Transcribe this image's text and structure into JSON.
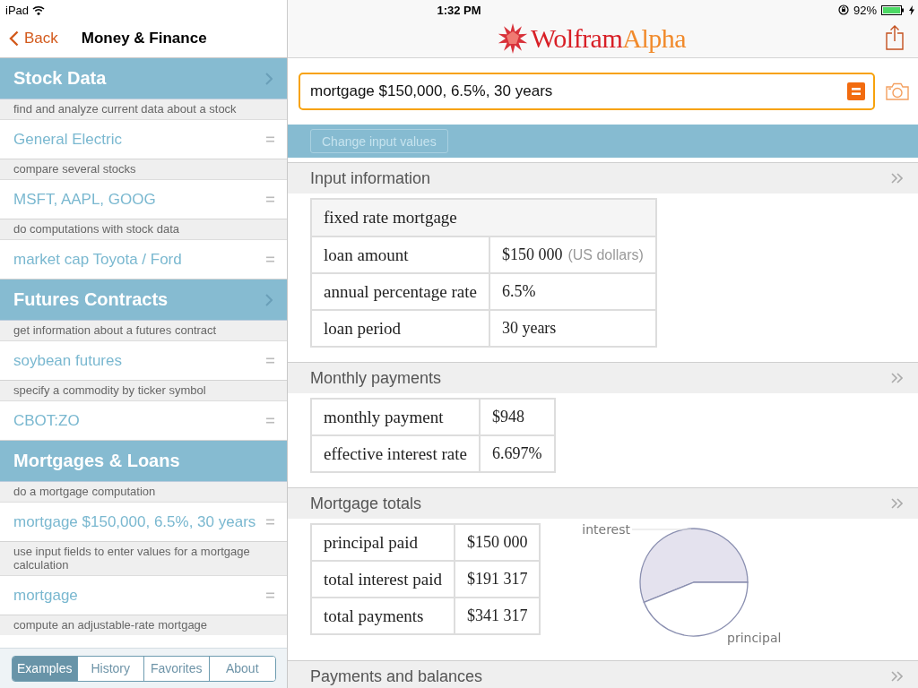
{
  "status_bar": {
    "device": "iPad",
    "time": "1:32 PM",
    "battery": "92%",
    "charging": true
  },
  "sidebar": {
    "back": "Back",
    "title": "Money & Finance",
    "sections": [
      {
        "heading": "Stock Data",
        "expandable": true,
        "examples": [
          {
            "description": "find and analyze current data about a stock",
            "query": "General Electric"
          },
          {
            "description": "compare several stocks",
            "query": "MSFT, AAPL, GOOG"
          },
          {
            "description": "do computations with stock data",
            "query": "market cap Toyota / Ford"
          }
        ]
      },
      {
        "heading": "Futures Contracts",
        "expandable": true,
        "examples": [
          {
            "description": "get information about a futures contract",
            "query": "soybean futures"
          },
          {
            "description": "specify a commodity by ticker symbol",
            "query": "CBOT:ZO"
          }
        ]
      },
      {
        "heading": "Mortgages & Loans",
        "expandable": false,
        "examples": [
          {
            "description": "do a mortgage computation",
            "query": "mortgage $150,000, 6.5%, 30 years"
          },
          {
            "description": "use input fields to enter values for a mortgage calculation",
            "query": "mortgage"
          },
          {
            "description": "compute an adjustable-rate mortgage"
          }
        ]
      }
    ],
    "tabs": [
      {
        "label": "Examples",
        "selected": true
      },
      {
        "label": "History",
        "selected": false
      },
      {
        "label": "Favorites",
        "selected": false
      },
      {
        "label": "About",
        "selected": false
      }
    ]
  },
  "main": {
    "logo": {
      "first": "Wolfram",
      "second": "Alpha"
    },
    "search": {
      "value": "mortgage $150,000, 6.5%, 30 years"
    },
    "change_button": {
      "label": "Change input values",
      "disabled": true
    },
    "pods": [
      {
        "title": "Input information",
        "table": {
          "caption": "fixed rate mortgage",
          "rows": [
            {
              "label": "loan amount",
              "value": "$150 000",
              "unit": "(US dollars)"
            },
            {
              "label": "annual percentage rate",
              "value": "6.5%"
            },
            {
              "label": "loan period",
              "value": "30 years"
            }
          ]
        }
      },
      {
        "title": "Monthly payments",
        "table": {
          "rows": [
            {
              "label": "monthly payment",
              "value": "$948"
            },
            {
              "label": "effective interest rate",
              "value": "6.697%"
            }
          ]
        }
      },
      {
        "title": "Mortgage totals",
        "table": {
          "rows": [
            {
              "label": "principal paid",
              "value": "$150 000"
            },
            {
              "label": "total interest paid",
              "value": "$191 317"
            },
            {
              "label": "total payments",
              "value": "$341 317"
            }
          ]
        },
        "pie_labels": [
          "interest",
          "principal"
        ]
      },
      {
        "title": "Payments and balances"
      }
    ]
  }
}
